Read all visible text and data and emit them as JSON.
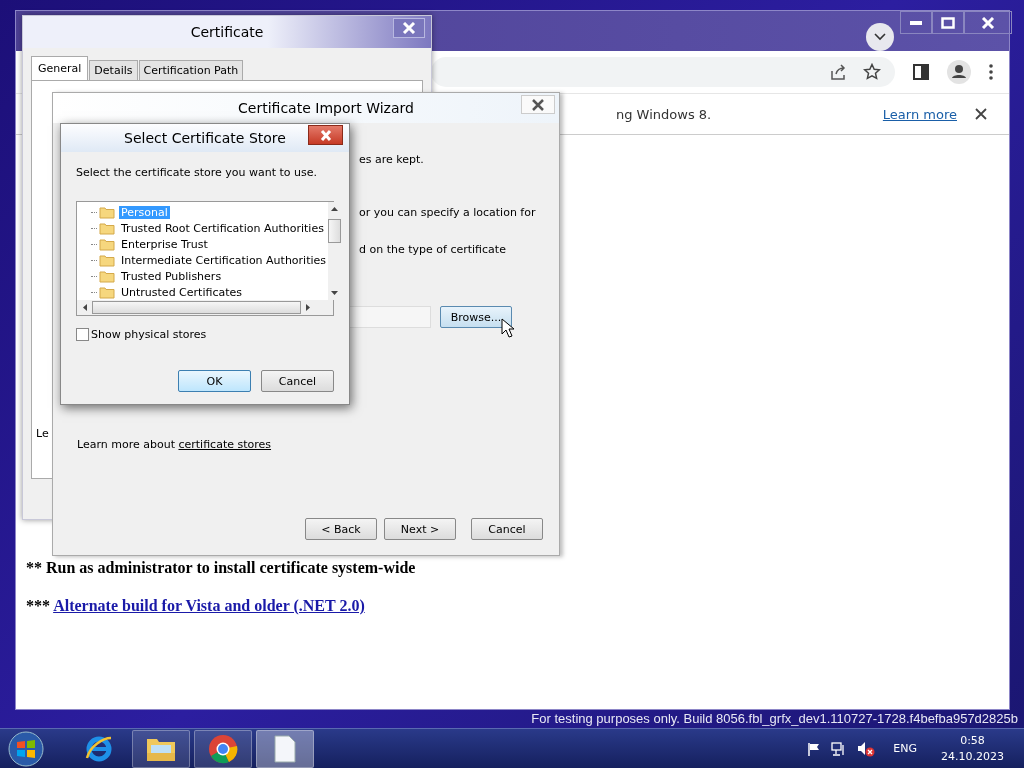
{
  "browser": {
    "infobar": {
      "message": "ng Windows 8.",
      "link": "Learn more"
    },
    "page_lines": [
      {
        "kind": "text",
        "prefix": "** ",
        "text": "Run as administrator to install certificate system-wide"
      },
      {
        "kind": "link",
        "prefix": "*** ",
        "text": "Alternate build for Vista and older (.NET 2.0)"
      }
    ]
  },
  "certificate_window": {
    "title": "Certificate",
    "tabs": [
      {
        "label": "General",
        "selected": true
      },
      {
        "label": "Details",
        "selected": false
      },
      {
        "label": "Certification Path",
        "selected": false
      }
    ],
    "fragment": "Le"
  },
  "wizard": {
    "title": "Certificate Import Wizard",
    "lines": [
      "es are kept.",
      "or you can specify a location for",
      "d on the type of certificate"
    ],
    "browse_button": "Browse...",
    "learn_more": {
      "text": "Learn more about ",
      "link": "certificate stores"
    },
    "buttons": [
      "< Back",
      "Next >",
      "Cancel"
    ]
  },
  "store_dialog": {
    "title": "Select Certificate Store",
    "instruction": "Select the certificate store you want to use.",
    "stores": [
      {
        "name": "Personal",
        "selected": true
      },
      {
        "name": "Trusted Root Certification Authorities",
        "selected": false
      },
      {
        "name": "Enterprise Trust",
        "selected": false
      },
      {
        "name": "Intermediate Certification Authorities",
        "selected": false
      },
      {
        "name": "Trusted Publishers",
        "selected": false
      },
      {
        "name": "Untrusted Certificates",
        "selected": false
      }
    ],
    "show_physical_stores": {
      "label": "Show physical stores",
      "checked": false
    },
    "buttons": [
      "OK",
      "Cancel"
    ]
  },
  "desktop": {
    "build_text": "For testing purposes only. Build 8056.fbl_grfx_dev1.110727-1728.f4befba957d2825b"
  },
  "taskbar": {
    "language": "ENG",
    "time": "0:58",
    "date": "24.10.2023"
  }
}
